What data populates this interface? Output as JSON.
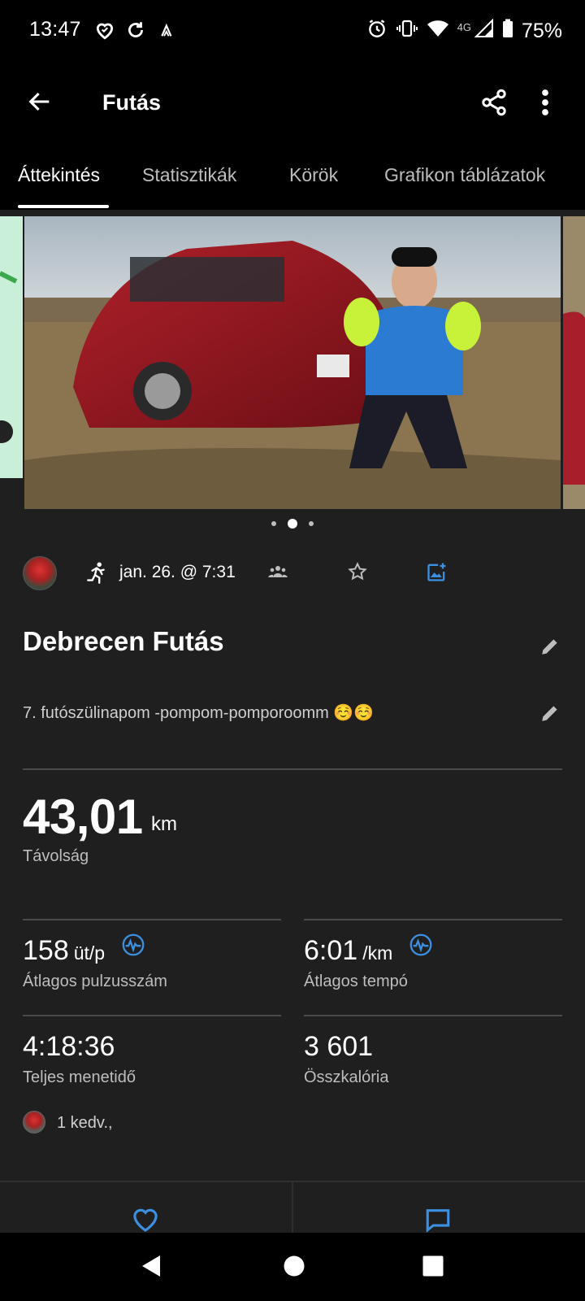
{
  "status_bar": {
    "time": "13:47",
    "network": "4G",
    "battery": "75%"
  },
  "app_bar": {
    "title": "Futás"
  },
  "tabs": [
    {
      "label": "Áttekintés",
      "active": true
    },
    {
      "label": "Statisztikák",
      "active": false
    },
    {
      "label": "Körök",
      "active": false
    },
    {
      "label": "Grafikon táblázatok",
      "active": false
    }
  ],
  "carousel": {
    "total_pages": 3,
    "current_page": 2
  },
  "activity": {
    "date_time": "jan. 26. @ 7:31",
    "title": "Debrecen Futás",
    "description": "7. futószülinapom -pompom-pomporoomm ☺️☺️"
  },
  "stats": {
    "distance": {
      "value": "43,01",
      "unit": "km",
      "label": "Távolság"
    },
    "avg_hr": {
      "value": "158",
      "unit": "üt/p",
      "label": "Átlagos pulzusszám"
    },
    "avg_pace": {
      "value": "6:01",
      "unit": "/km",
      "label": "Átlagos tempó"
    },
    "total_time": {
      "value": "4:18:36",
      "label": "Teljes menetidő"
    },
    "calories": {
      "value": "3 601",
      "label": "Összkalória"
    }
  },
  "social": {
    "likes_text": "1 kedv.,"
  },
  "colors": {
    "accent_blue": "#3d8fe0",
    "background": "#1f1f1f",
    "divider": "#4a4a4a"
  }
}
